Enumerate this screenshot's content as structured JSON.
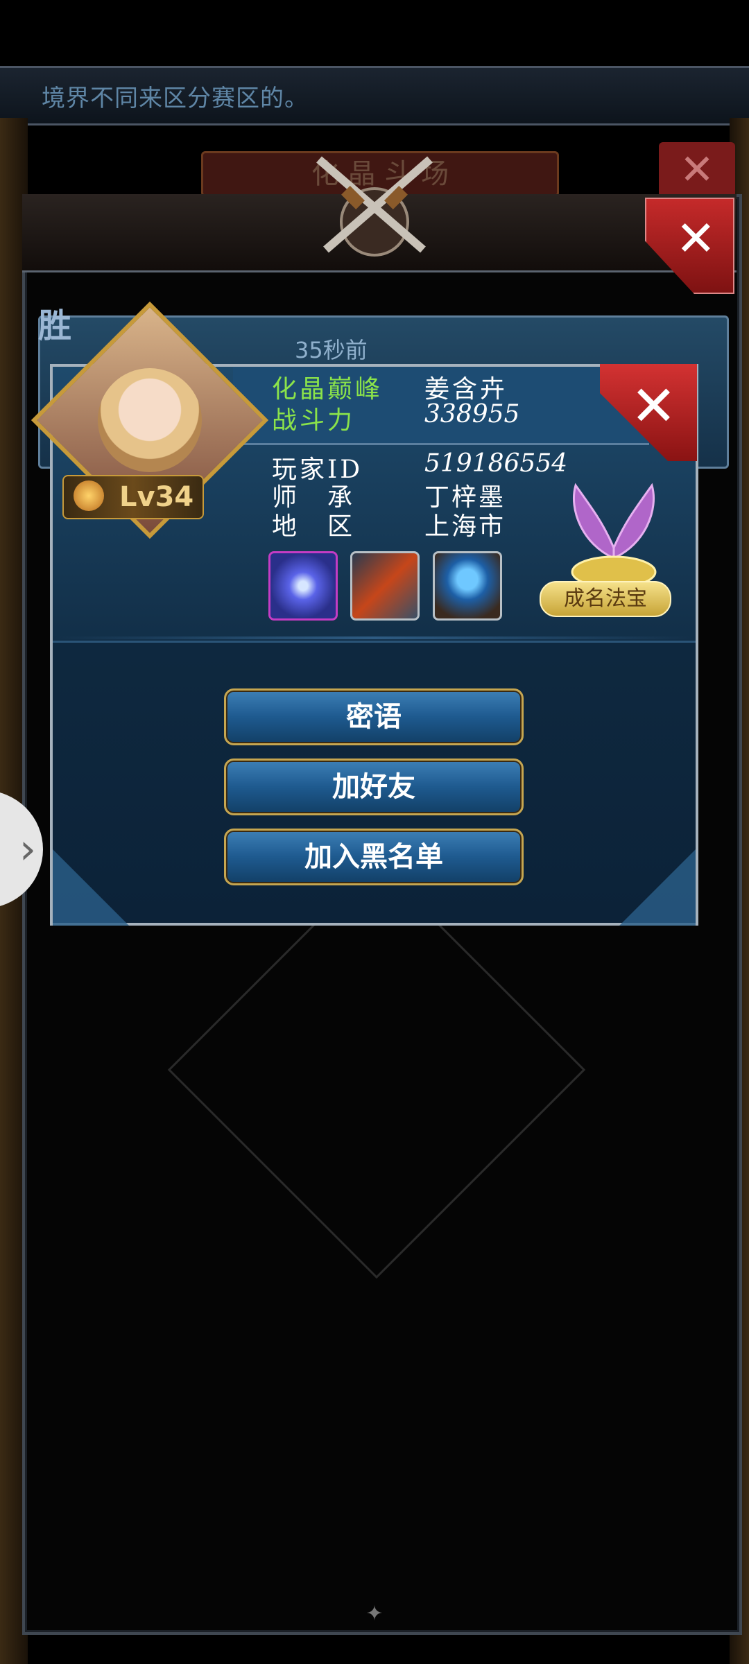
{
  "background": {
    "banner_message": "境界不同来区分赛区的。",
    "tab_title": "化 晶 斗 场",
    "win_badge": "胜",
    "record_time": "35秒前"
  },
  "player_card": {
    "title_label": "化晶巅峰",
    "character_name": "姜含卉",
    "power_label": "战斗力",
    "power_value": "338955",
    "level": "Lv34",
    "fields": [
      {
        "label": "玩家ID",
        "value": "519186554"
      },
      {
        "label": "师　承",
        "value": "丁梓墨"
      },
      {
        "label": "地　区",
        "value": "上海市"
      }
    ],
    "skills": [
      "blue-orb-skill-icon",
      "meteor-skill-icon",
      "water-orb-skill-icon"
    ],
    "treasure_label": "成名法宝",
    "buttons": {
      "whisper": "密语",
      "add_friend": "加好友",
      "blacklist": "加入黑名单"
    }
  },
  "colors": {
    "title_green": "#8be34a",
    "button_blue": "#1e5a8f",
    "close_red": "#c52a2a",
    "gold": "#c6a650"
  }
}
